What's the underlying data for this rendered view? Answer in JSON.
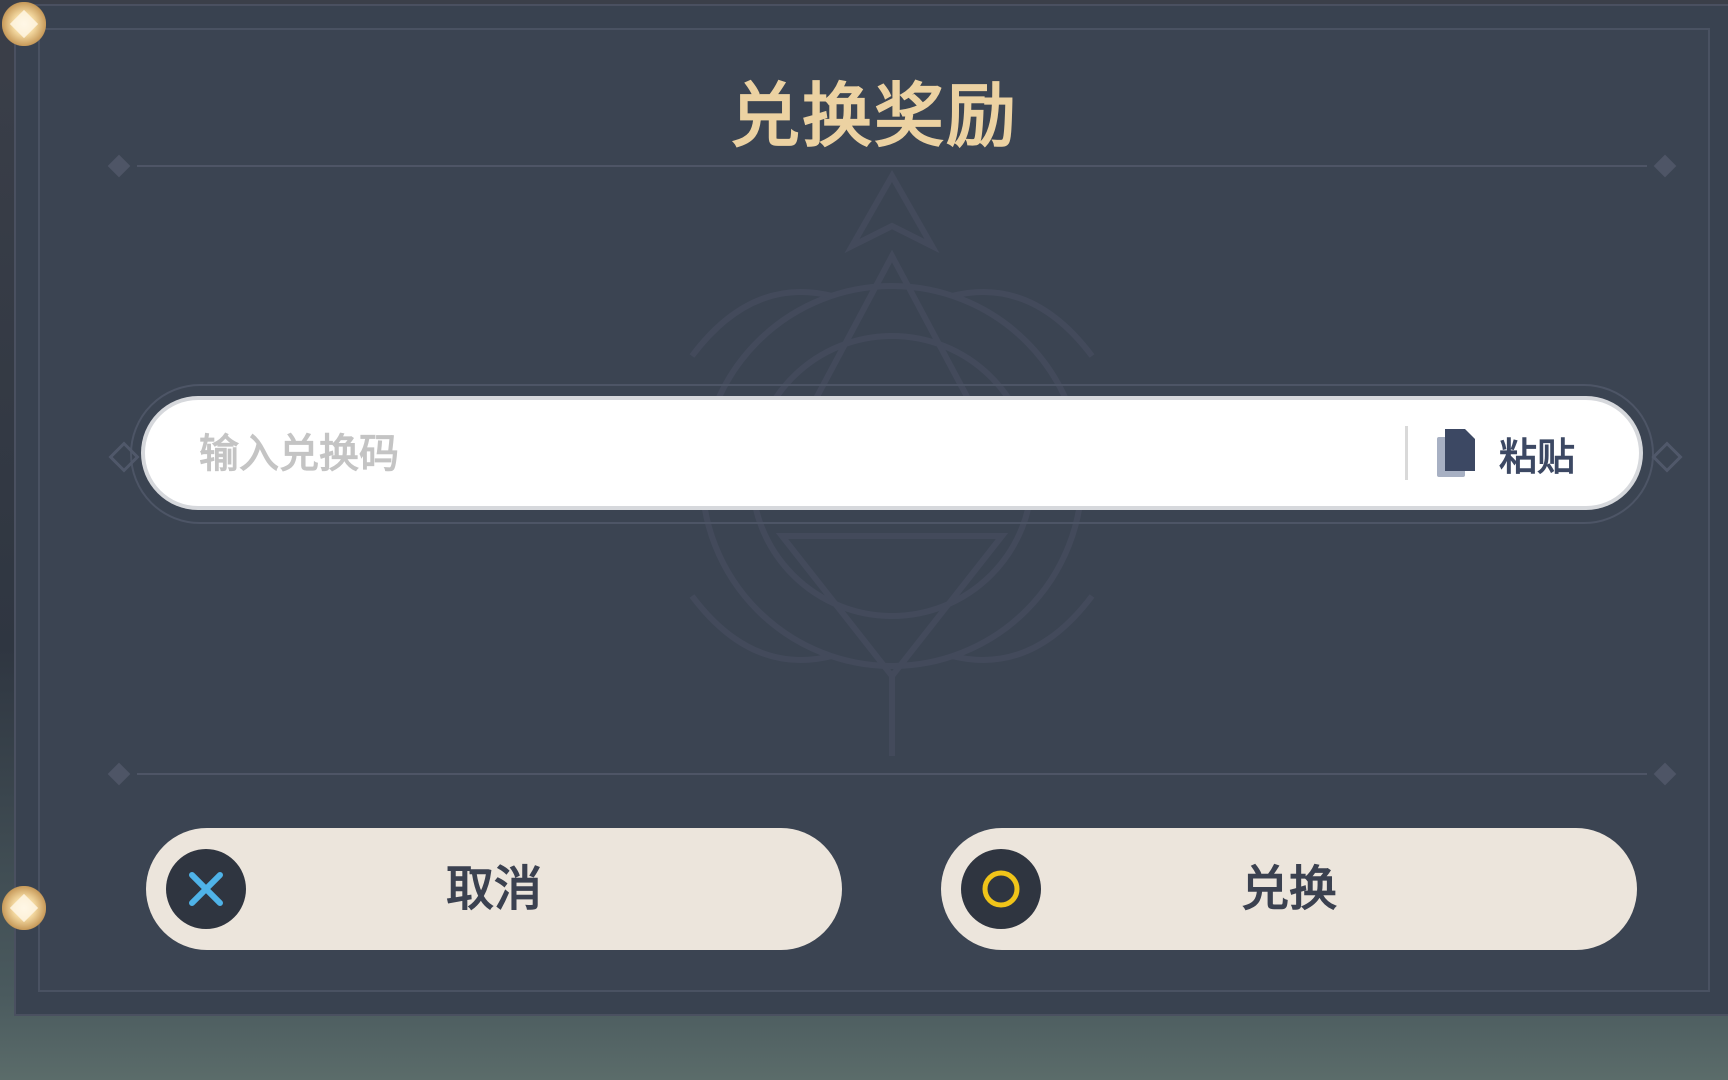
{
  "dialog": {
    "title": "兑换奖励"
  },
  "code_input": {
    "placeholder": "输入兑换码",
    "value": ""
  },
  "paste_button": {
    "label": "粘贴",
    "icon": "document-copy-icon"
  },
  "buttons": {
    "cancel": {
      "label": "取消",
      "icon": "close-x-icon",
      "icon_color": "#4fb3e8"
    },
    "confirm": {
      "label": "兑换",
      "icon": "circle-o-icon",
      "icon_color": "#f0c419"
    }
  },
  "colors": {
    "panel": "#3b4452",
    "title": "#ecd2a2",
    "button_bg": "#ece5dc"
  }
}
